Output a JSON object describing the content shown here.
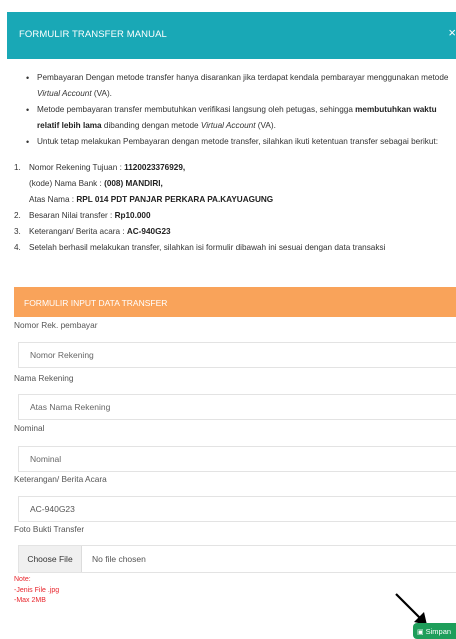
{
  "modal": {
    "title": "FORMULIR TRANSFER MANUAL",
    "close_icon": "×"
  },
  "info": {
    "bullet1": "Pembayaran Dengan metode transfer hanya disarankan jika terdapat kendala pembarayar menggunakan metode",
    "bullet1_italic": "Virtual Account",
    "bullet1_end": "(VA).",
    "bullet2_a": "Metode pembayaran transfer membutuhkan verifikasi langsung oleh petugas, sehingga",
    "bullet2_bold": "membutuhkan waktu relatif lebih lama",
    "bullet2_b": "dibanding dengan metode",
    "bullet2_italic": "Virtual Account",
    "bullet2_end": "(VA).",
    "bullet3": "Untuk tetap melakukan Pembayaran dengan metode transfer, silahkan ikuti ketentuan transfer sebagai berikut:",
    "steps": {
      "n1": "1.",
      "rek_label": "Nomor Rekening Tujuan : ",
      "rek_value": "1120023376929,",
      "bank_label": "(kode) Nama Bank : ",
      "bank_value": "(008) MANDIRI,",
      "atas_label": "Atas Nama : ",
      "atas_value": "RPL 014 PDT PANJAR PERKARA PA.KAYUAGUNG",
      "n2": "2.",
      "besaran_label": "Besaran Nilai transfer : ",
      "besaran_value": "Rp10.000",
      "n3": "3.",
      "ket_label": "Keterangan/ Berita acara : ",
      "ket_value": "AC-940G23",
      "n4": "4.",
      "step4": "Setelah berhasil melakukan transfer, silahkan isi formulir dibawah ini sesuai dengan data transaksi"
    }
  },
  "form": {
    "section_title": "FORMULIR INPUT DATA TRANSFER",
    "rek_label": "Nomor Rek. pembayar",
    "rek_placeholder": "Nomor Rekening",
    "nama_label": "Nama Rekening",
    "nama_placeholder": "Atas Nama Rekening",
    "nominal_label": "Nominal",
    "nominal_placeholder": "Nominal",
    "ket_label": "Keterangan/ Berita Acara",
    "ket_value": "AC-940G23",
    "foto_label": "Foto Bukti Transfer",
    "file_button": "Choose File",
    "file_status": "No file chosen",
    "note_title": "Note:",
    "note_line1": "-Jenis File .jpg",
    "note_line2": "-Max 2MB",
    "save_label": "Simpan",
    "save_icon": "save-icon"
  },
  "colors": {
    "header": "#19a8b6",
    "section_header": "#f9a35a",
    "note": "#e8242b",
    "save_button": "#1e9e5a"
  }
}
